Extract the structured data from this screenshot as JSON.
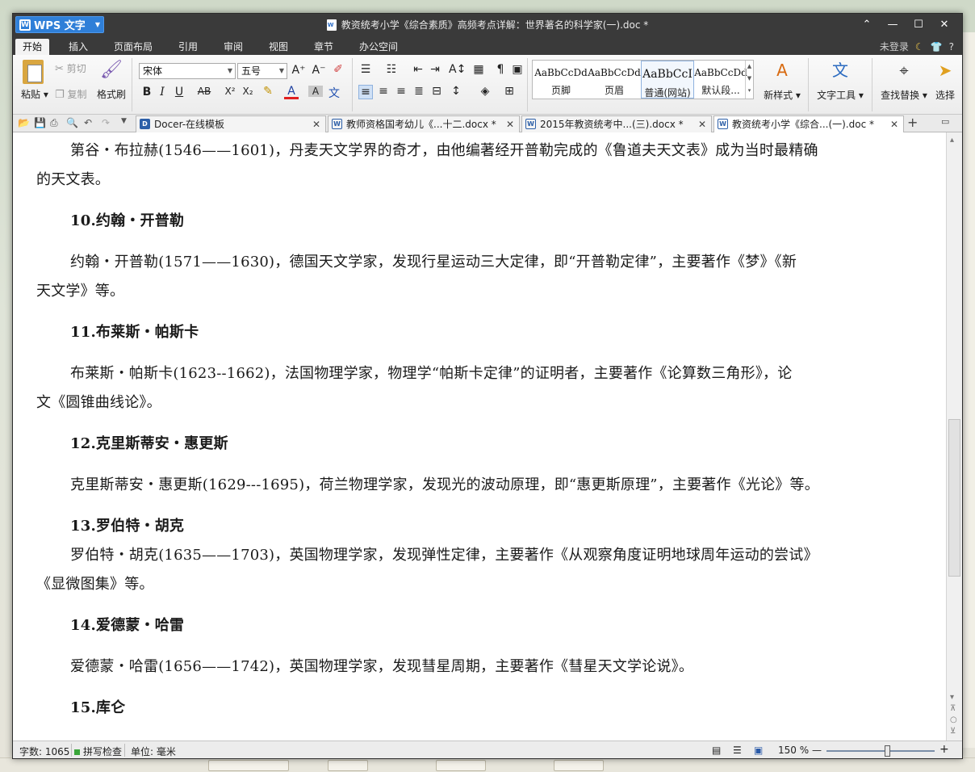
{
  "window": {
    "app_name": "WPS 文字",
    "title": "教资统考小学《综合素质》高频考点详解：世界著名的科学家(一).doc *",
    "controls": {
      "collapse": "⌃",
      "minimize": "—",
      "maximize": "☐",
      "close": "✕"
    }
  },
  "menu": {
    "tabs": [
      "开始",
      "插入",
      "页面布局",
      "引用",
      "审阅",
      "视图",
      "章节",
      "办公空间"
    ],
    "active": "开始",
    "login": "未登录",
    "help": "?"
  },
  "ribbon": {
    "paste": "粘贴",
    "cut": "剪切",
    "copy": "复制",
    "format_painter": "格式刷",
    "font_name": "宋体",
    "font_size": "五号",
    "styles": [
      {
        "sample": "AaBbCcDd",
        "label": "页脚"
      },
      {
        "sample": "AaBbCcDd",
        "label": "页眉"
      },
      {
        "sample": "AaBbCcI",
        "label": "普通(网站)"
      },
      {
        "sample": "AaBbCcDd",
        "label": "默认段..."
      }
    ],
    "new_style": "新样式",
    "text_tools": "文字工具",
    "find_replace": "查找替换",
    "select": "选择"
  },
  "tabs": [
    {
      "icon": "D",
      "label": "Docer-在线模板"
    },
    {
      "icon": "W",
      "label": "教师资格国考幼儿《...十二.docx *"
    },
    {
      "icon": "W",
      "label": "2015年教资统考中...(三).docx *"
    },
    {
      "icon": "W",
      "label": "教资统考小学《综合...(一).doc *"
    }
  ],
  "doc": {
    "lines": [
      {
        "type": "para-first",
        "text": "第谷・布拉赫(1546——1601)，丹麦天文学界的奇才，由他编著经开普勒完成的《鲁道夫天文表》成为当时最精确"
      },
      {
        "type": "para-cont",
        "text": "的天文表。"
      },
      {
        "type": "heading",
        "text": "10.约翰・开普勒"
      },
      {
        "type": "para-first",
        "text": "约翰・开普勒(1571——1630)，德国天文学家，发现行星运动三大定律，即“开普勒定律”，主要著作《梦》《新"
      },
      {
        "type": "para-cont",
        "text": "天文学》等。"
      },
      {
        "type": "heading",
        "text": "11.布莱斯・帕斯卡"
      },
      {
        "type": "para-first",
        "text": "布莱斯・帕斯卡(1623--1662)，法国物理学家，物理学“帕斯卡定律”的证明者，主要著作《论算数三角形》，论"
      },
      {
        "type": "para-cont",
        "text": "文《圆锥曲线论》。"
      },
      {
        "type": "heading",
        "text": "12.克里斯蒂安・惠更斯"
      },
      {
        "type": "para-first",
        "text": "克里斯蒂安・惠更斯(1629---1695)，荷兰物理学家，发现光的波动原理，即“惠更斯原理”，主要著作《光论》等。"
      },
      {
        "type": "heading",
        "text": "13.罗伯特・胡克"
      },
      {
        "type": "para-first",
        "text": "罗伯特・胡克(1635——1703)，英国物理学家，发现弹性定律，主要著作《从观察角度证明地球周年运动的尝试》"
      },
      {
        "type": "para-cont",
        "text": "《显微图集》等。"
      },
      {
        "type": "heading",
        "text": "14.爱德蒙・哈雷"
      },
      {
        "type": "para-first",
        "text": "爱德蒙・哈雷(1656——1742)，英国物理学家，发现彗星周期，主要著作《彗星天文学论说》。"
      },
      {
        "type": "heading",
        "text": "15.库仑"
      }
    ]
  },
  "status": {
    "word_count": "字数: 1065",
    "spell_check": "拼写检查",
    "unit": "单位: 毫米",
    "zoom": "150 %",
    "zoom_minus": "—",
    "zoom_plus": "+"
  }
}
